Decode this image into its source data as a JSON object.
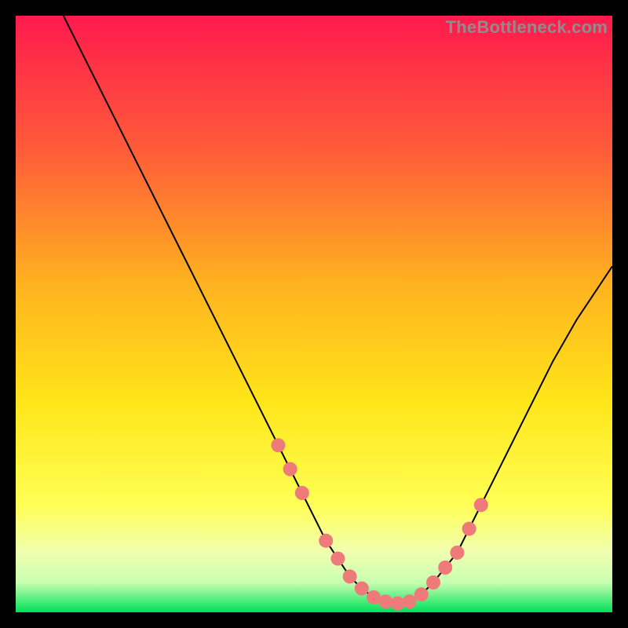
{
  "watermark": "TheBottleneck.com",
  "colors": {
    "bg_black": "#000000",
    "gradient_top": "#ff1a4d",
    "gradient_mid1": "#ff7a33",
    "gradient_mid2": "#ffd21f",
    "gradient_mid3": "#ffff4d",
    "gradient_pale": "#f6ffb0",
    "gradient_bottom": "#00e05a",
    "curve": "#000000",
    "marker": "#ef7a7a"
  },
  "chart_data": {
    "type": "line",
    "title": "",
    "xlabel": "",
    "ylabel": "",
    "xlim": [
      0,
      100
    ],
    "ylim": [
      0,
      100
    ],
    "series": [
      {
        "name": "bottleneck-curve",
        "x": [
          8,
          12,
          16,
          20,
          24,
          28,
          32,
          36,
          40,
          44,
          48,
          52,
          54,
          56,
          58,
          60,
          62,
          64,
          66,
          68,
          70,
          74,
          78,
          82,
          86,
          90,
          94,
          98,
          100
        ],
        "y": [
          100,
          92,
          84,
          76,
          68,
          60,
          52,
          44,
          36,
          28,
          20,
          12,
          9,
          6,
          4,
          2.5,
          1.8,
          1.5,
          1.8,
          3,
          5,
          10,
          18,
          26,
          34,
          42,
          49,
          55,
          58
        ]
      }
    ],
    "markers": {
      "name": "highlight-points",
      "x": [
        44,
        46,
        48,
        52,
        54,
        56,
        58,
        60,
        62,
        64,
        66,
        68,
        70,
        72,
        74,
        76,
        78
      ],
      "y": [
        28,
        24,
        20,
        12,
        9,
        6,
        4,
        2.5,
        1.8,
        1.5,
        1.8,
        3,
        5,
        7.5,
        10,
        14,
        18
      ]
    }
  }
}
